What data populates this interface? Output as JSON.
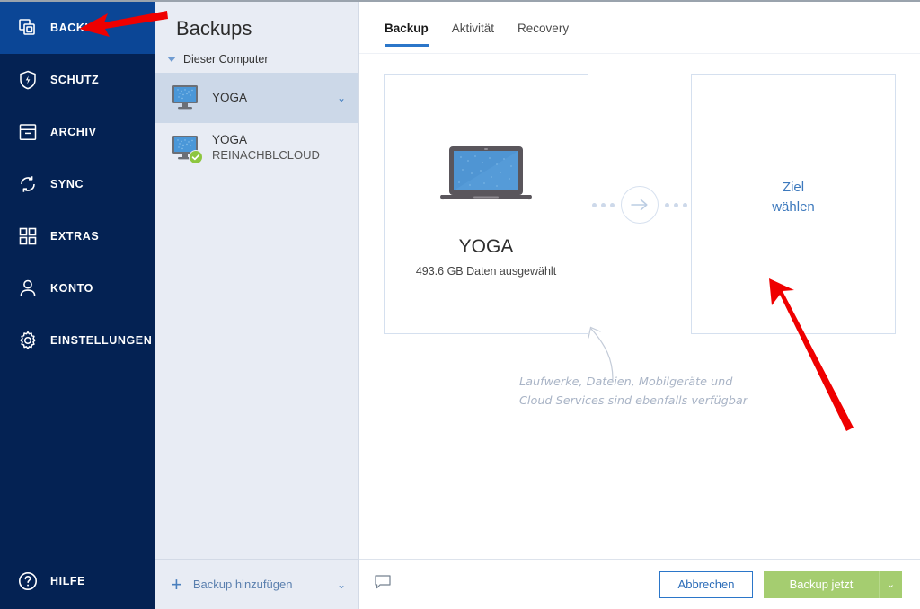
{
  "nav": {
    "items": [
      {
        "label": "BACKUP",
        "icon": "backup-copies-icon",
        "active": true
      },
      {
        "label": "SCHUTZ",
        "icon": "shield-bolt-icon",
        "active": false
      },
      {
        "label": "ARCHIV",
        "icon": "archive-box-icon",
        "active": false
      },
      {
        "label": "SYNC",
        "icon": "sync-refresh-icon",
        "active": false
      },
      {
        "label": "EXTRAS",
        "icon": "grid-squares-icon",
        "active": false
      },
      {
        "label": "KONTO",
        "icon": "user-person-icon",
        "active": false
      },
      {
        "label": "EINSTELLUNGEN",
        "icon": "gear-settings-icon",
        "active": false
      }
    ],
    "help": {
      "label": "HILFE",
      "icon": "question-circle-icon"
    }
  },
  "backups_panel": {
    "title": "Backups",
    "group_label": "Dieser Computer",
    "items": [
      {
        "name": "YOGA",
        "sub": "",
        "selected": true,
        "badge": false,
        "chevron": "⌄"
      },
      {
        "name": "YOGA",
        "sub": "REINACHBLCLOUD",
        "selected": false,
        "badge": true,
        "chevron": ""
      }
    ],
    "footer": {
      "add_label": "Backup hinzufügen",
      "plus": "+",
      "chevron": "⌄"
    }
  },
  "main": {
    "tabs": [
      {
        "label": "Backup",
        "active": true
      },
      {
        "label": "Aktivität",
        "active": false
      },
      {
        "label": "Recovery",
        "active": false
      }
    ],
    "source_card": {
      "title": "YOGA",
      "subtitle": "493.6 GB Daten ausgewählt",
      "icon": "laptop-icon"
    },
    "destination_card": {
      "line1": "Ziel",
      "line2": "wählen"
    },
    "hint": "Laufwerke, Dateien, Mobilgeräte und Cloud Services sind ebenfalls verfügbar"
  },
  "actionbar": {
    "feedback_icon": "speech-bubble-icon",
    "cancel_label": "Abbrechen",
    "primary_label": "Backup jetzt",
    "primary_caret": "⌄"
  },
  "annotations": [
    {
      "name": "arrow-to-backup-nav",
      "color": "#ef0000"
    },
    {
      "name": "arrow-to-destination",
      "color": "#ef0000"
    }
  ],
  "colors": {
    "nav_bg": "#042253",
    "nav_active": "#0b4696",
    "panel_bg": "#e8ecf4",
    "panel_selected": "#ccd8e8",
    "accent_blue": "#2b76c9",
    "link_blue": "#3d79bd",
    "primary_green": "#a5cd70",
    "badge_green": "#8dc63f",
    "annotation_red": "#ef0000"
  }
}
